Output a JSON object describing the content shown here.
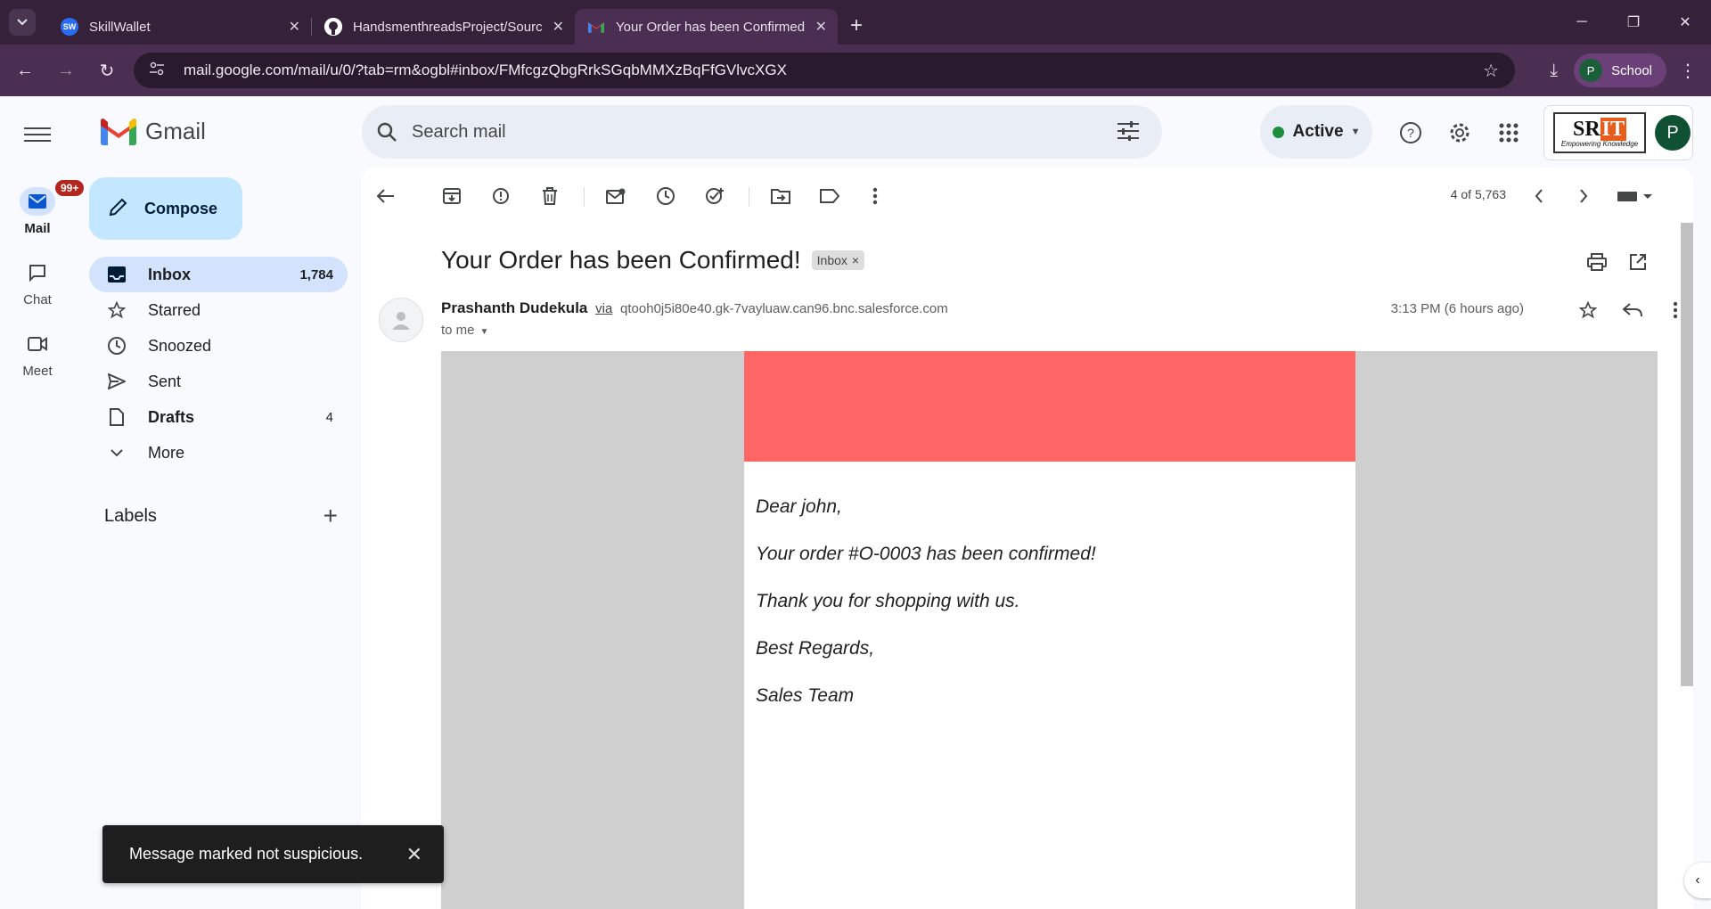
{
  "browser": {
    "tabs": [
      {
        "label": "SkillWallet",
        "favicon": "SW",
        "active": false
      },
      {
        "label": "HandsmenthreadsProject/Sourc",
        "favicon": "github",
        "active": false
      },
      {
        "label": "Your Order has been Confirmed",
        "favicon": "gmail",
        "active": true
      }
    ],
    "url": "mail.google.com/mail/u/0/?tab=rm&ogbl#inbox/FMfcgzQbgRrkSGqbMMXzBqFfGVlvcXGX",
    "profile_label": "School",
    "profile_initial": "P"
  },
  "rail": {
    "mail_label": "Mail",
    "mail_badge": "99+",
    "chat_label": "Chat",
    "meet_label": "Meet"
  },
  "header": {
    "app_name": "Gmail",
    "search_placeholder": "Search mail",
    "status_label": "Active",
    "account_initial": "P",
    "org_logo_big_1": "SR",
    "org_logo_big_2": "IT",
    "org_logo_tagline": "Empowering Knowledge"
  },
  "sidebar": {
    "compose_label": "Compose",
    "items": [
      {
        "label": "Inbox",
        "count": "1,784",
        "icon": "inbox-icon"
      },
      {
        "label": "Starred",
        "count": "",
        "icon": "star-icon"
      },
      {
        "label": "Snoozed",
        "count": "",
        "icon": "clock-icon"
      },
      {
        "label": "Sent",
        "count": "",
        "icon": "send-icon"
      },
      {
        "label": "Drafts",
        "count": "4",
        "icon": "draft-icon"
      },
      {
        "label": "More",
        "count": "",
        "icon": "chevron-down-icon"
      }
    ],
    "labels_heading": "Labels"
  },
  "message": {
    "pager": "4 of 5,763",
    "subject": "Your Order has been Confirmed!",
    "label_chip": "Inbox",
    "sender_name": "Prashanth Dudekula",
    "via": "via",
    "sender_address": "qtooh0j5i80e40.gk-7vayluaw.can96.bnc.salesforce.com",
    "recipient": "to me",
    "time": "3:13 PM (6 hours ago)",
    "body_lines": [
      "Dear john,",
      "Your order #O-0003 has been confirmed!",
      "Thank you for shopping with us.",
      "Best Regards,",
      "Sales Team"
    ],
    "banner_color": "#ff6666"
  },
  "toast": {
    "text": "Message marked not suspicious."
  }
}
